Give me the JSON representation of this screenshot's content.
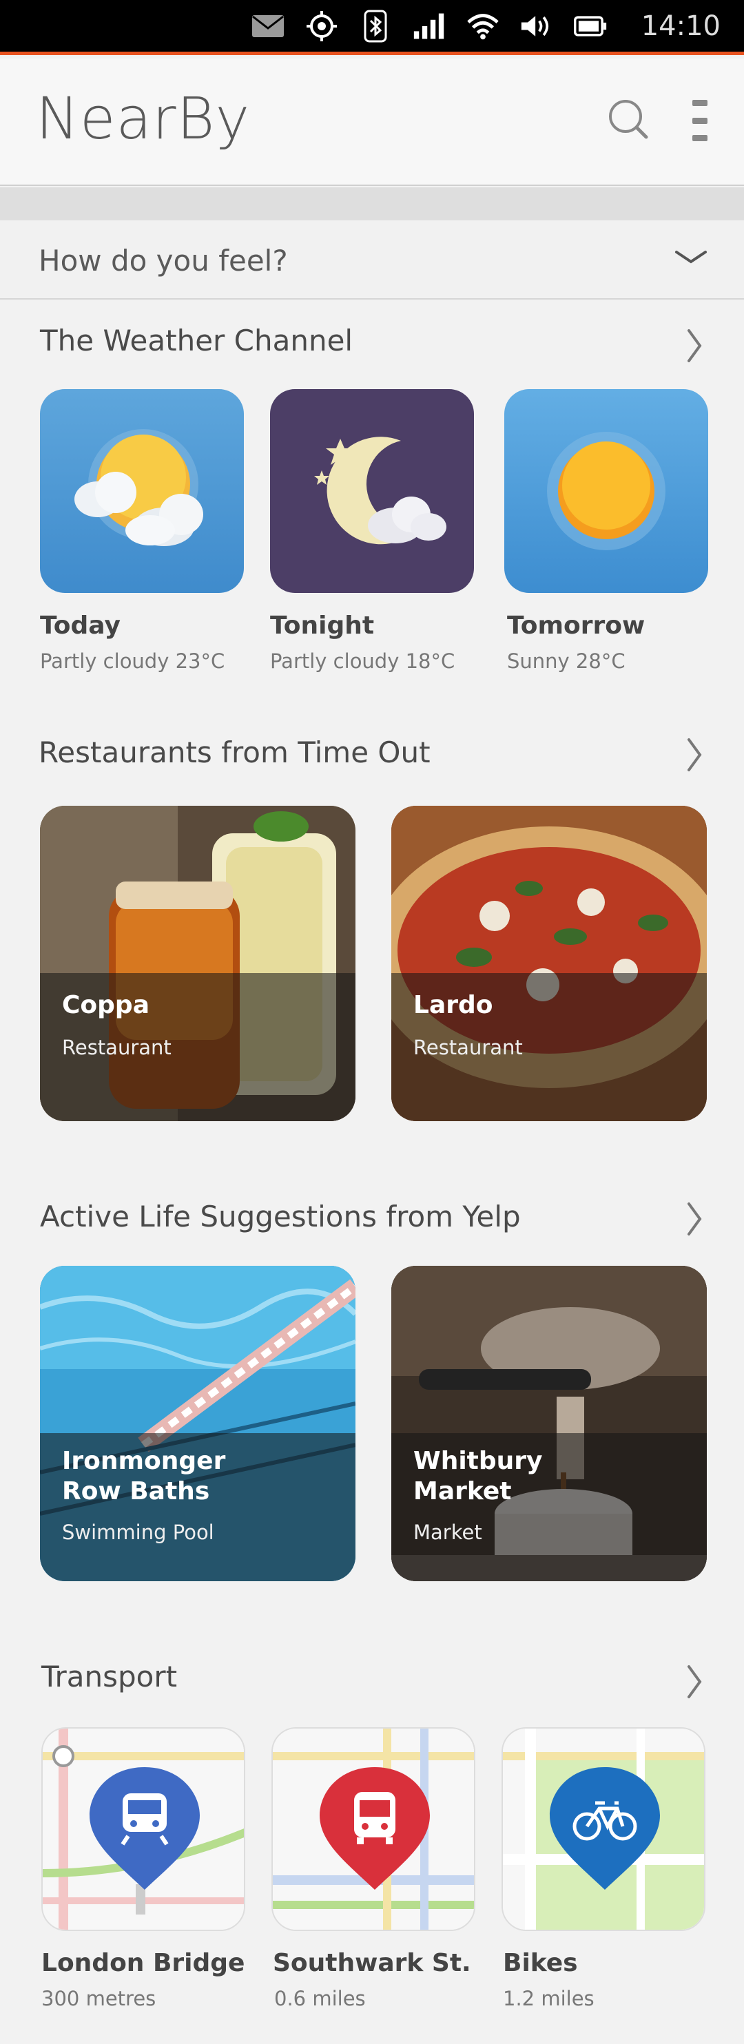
{
  "status": {
    "time": "14:10",
    "icons": [
      "mail-icon",
      "location-icon",
      "bluetooth-icon",
      "signal-icon",
      "wifi-icon",
      "volume-icon",
      "battery-icon"
    ]
  },
  "header": {
    "title": "NearBy"
  },
  "feel": {
    "label": "How do you feel?"
  },
  "weather": {
    "title": "The Weather Channel",
    "items": [
      {
        "name": "Today",
        "desc": "Partly cloudy  23°C",
        "icon": "partly-cloudy-icon"
      },
      {
        "name": "Tonight",
        "desc": "Partly cloudy 18°C",
        "icon": "night-cloudy-icon"
      },
      {
        "name": "Tomorrow",
        "desc": "Sunny 28°C",
        "icon": "sun-icon"
      }
    ]
  },
  "restaurants": {
    "title": "Restaurants from Time Out",
    "items": [
      {
        "name": "Coppa",
        "type": "Restaurant"
      },
      {
        "name": "Lardo",
        "type": "Restaurant"
      }
    ]
  },
  "active": {
    "title": "Active Life Suggestions from Yelp",
    "items": [
      {
        "name": "Ironmonger\nRow Baths",
        "line1": "Ironmonger",
        "line2": "Row Baths",
        "type": "Swimming Pool"
      },
      {
        "name": "Whitbury\nMarket",
        "line1": "Whitbury",
        "line2": "Market",
        "type": "Market"
      }
    ]
  },
  "transport": {
    "title": "Transport",
    "items": [
      {
        "name": "London Bridge",
        "distance": "300 metres",
        "icon": "train-icon",
        "color": "#3f6ac4"
      },
      {
        "name": "Southwark St.",
        "distance": "0.6 miles",
        "icon": "bus-icon",
        "color": "#d9303b"
      },
      {
        "name": "Bikes",
        "distance": "1.2 miles",
        "icon": "bike-icon",
        "color": "#1d6fbf"
      }
    ]
  },
  "colors": {
    "accent": "#e95420"
  }
}
